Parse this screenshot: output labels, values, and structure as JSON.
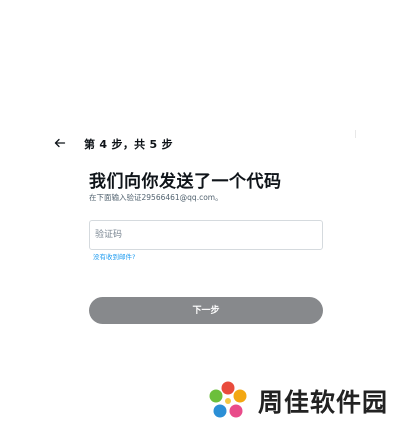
{
  "header": {
    "back_icon": "arrow-left-icon",
    "step_text": "第 4 步，共 5 步"
  },
  "main": {
    "title": "我们向你发送了一个代码",
    "subtitle": "在下面输入验证29566461@qq.com。",
    "code_input": {
      "placeholder": "验证码",
      "value": ""
    },
    "resend_link": "没有收到邮件?",
    "next_button": "下一步"
  },
  "watermark": {
    "text": "周佳软件园",
    "logo_icon": "flower-logo-icon"
  },
  "colors": {
    "link": "#1d9bf0",
    "button_disabled": "#87898c",
    "text_primary": "#0f1419",
    "text_secondary": "#536471"
  }
}
